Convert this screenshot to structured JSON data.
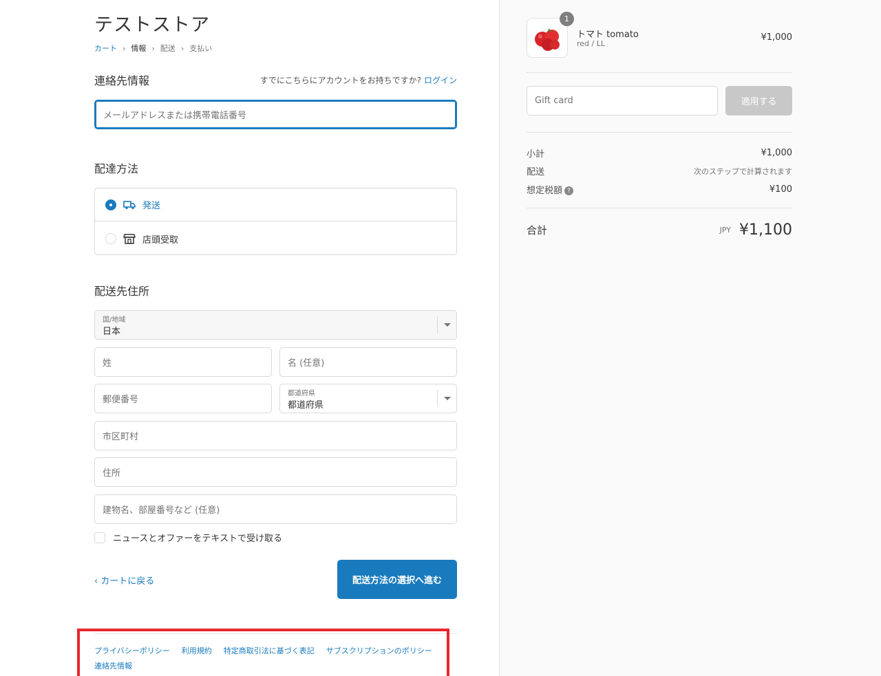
{
  "store": {
    "title": "テストストア"
  },
  "breadcrumb": {
    "cart": "カート",
    "info": "情報",
    "shipping": "配送",
    "payment": "支払い",
    "sep": "›"
  },
  "contact": {
    "heading": "連絡先情報",
    "have_account": "すでにこちらにアカウントをお持ちですか?",
    "login": "ログイン",
    "email_placeholder": "メールアドレスまたは携帯電話番号"
  },
  "delivery": {
    "heading": "配達方法",
    "options": [
      {
        "label": "発送",
        "selected": true,
        "icon": "truck-icon"
      },
      {
        "label": "店頭受取",
        "selected": false,
        "icon": "store-icon"
      }
    ]
  },
  "address": {
    "heading": "配送先住所",
    "country_label": "国/地域",
    "country_value": "日本",
    "last_name": "姓",
    "first_name": "名 (任意)",
    "postal_code": "郵便番号",
    "prefecture_label": "都道府県",
    "prefecture_value": "都道府県",
    "city": "市区町村",
    "address1": "住所",
    "address2": "建物名、部屋番号など (任意)",
    "news_checkbox": "ニュースとオファーをテキストで受け取る"
  },
  "actions": {
    "back": "‹ カートに戻る",
    "continue": "配送方法の選択へ進む"
  },
  "footer": {
    "links": [
      "プライバシーポリシー",
      "利用規約",
      "特定商取引法に基づく表記",
      "サブスクリプションのポリシー",
      "連絡先情報"
    ]
  },
  "cart": {
    "item": {
      "name": "トマト tomato",
      "variant": "red / LL",
      "price": "¥1,000",
      "quantity": "1"
    },
    "gift_placeholder": "Gift card",
    "apply": "適用する",
    "subtotal_label": "小計",
    "subtotal_value": "¥1,000",
    "shipping_label": "配送",
    "shipping_value": "次のステップで計算されます",
    "tax_label": "想定税額",
    "tax_value": "¥100",
    "total_label": "合計",
    "currency": "JPY",
    "total_value": "¥1,100"
  },
  "colors": {
    "accent": "#197bbd",
    "highlight": "#e8262d"
  }
}
